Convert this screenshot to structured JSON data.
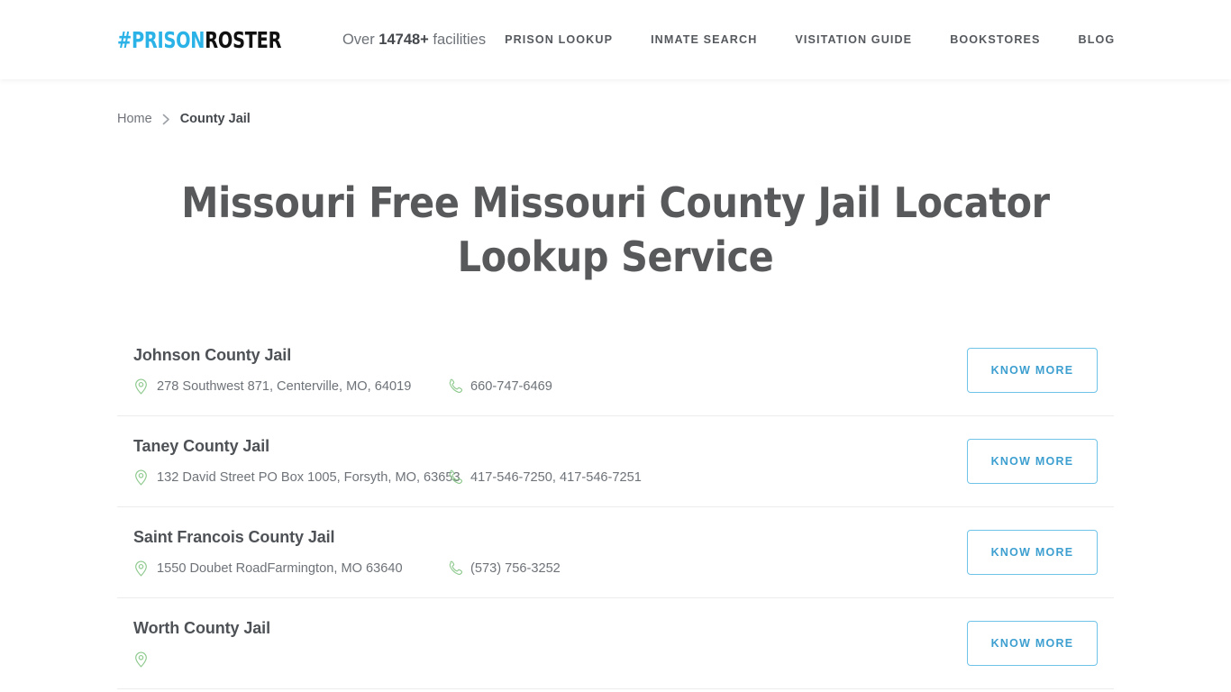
{
  "header": {
    "logo": {
      "hash": "#",
      "prison": "PRISON",
      "roster": "ROSTER",
      "accent_color": "#2BB3E8"
    },
    "facilities_prefix": "Over ",
    "facilities_count": "14748+",
    "facilities_suffix": " facilities",
    "nav": [
      {
        "label": "PRISON LOOKUP",
        "name": "nav-prison-lookup"
      },
      {
        "label": "INMATE SEARCH",
        "name": "nav-inmate-search"
      },
      {
        "label": "VISITATION GUIDE",
        "name": "nav-visitation-guide"
      },
      {
        "label": "BOOKSTORES",
        "name": "nav-bookstores"
      },
      {
        "label": "BLOG",
        "name": "nav-blog"
      }
    ]
  },
  "breadcrumb": {
    "home": "Home",
    "separator": "›",
    "current": "County Jail"
  },
  "page_title": "Missouri Free Missouri County Jail Locator Lookup Service",
  "listing": {
    "button_label": "KNOW MORE",
    "icons": {
      "address": "map-pin-icon",
      "phone": "phone-icon",
      "icon_color": "#8ec98e"
    },
    "rows": [
      {
        "name": "Johnson County Jail",
        "address": "278 Southwest 871, Centerville, MO, 64019",
        "phone": "660-747-6469"
      },
      {
        "name": "Taney County Jail",
        "address": "132 David Street PO Box 1005, Forsyth, MO, 63653",
        "phone": "417-546-7250, 417-546-7251"
      },
      {
        "name": "Saint Francois County Jail",
        "address": "1550 Doubet RoadFarmington, MO 63640",
        "phone": "(573) 756-3252"
      },
      {
        "name": "Worth County Jail",
        "address": "",
        "phone": ""
      }
    ]
  }
}
